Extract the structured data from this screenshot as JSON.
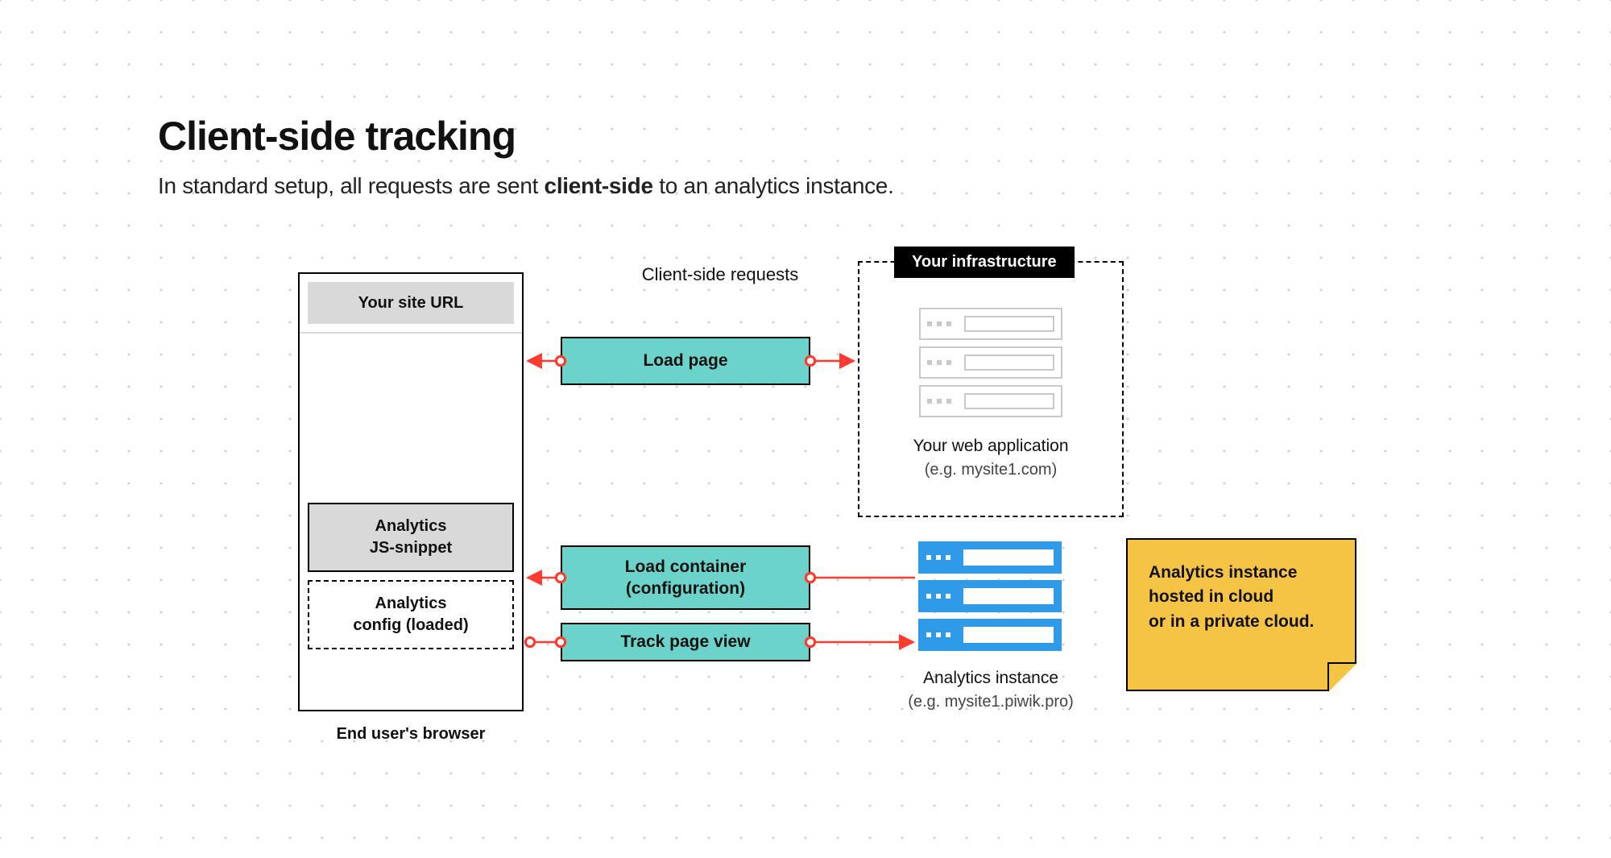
{
  "title": "Client-side tracking",
  "subtitle_pre": "In standard setup, all requests are sent ",
  "subtitle_bold": "client-side",
  "subtitle_post": " to an analytics instance.",
  "requests_label": "Client-side requests",
  "browser": {
    "url_label": "Your site URL",
    "snippet_l1": "Analytics",
    "snippet_l2": "JS-snippet",
    "config_l1": "Analytics",
    "config_l2": "config (loaded)",
    "caption": "End user's browser"
  },
  "requests": {
    "load_page": "Load page",
    "load_container_l1": "Load container",
    "load_container_l2": "(configuration)",
    "track_page_view": "Track page view"
  },
  "infrastructure": {
    "label": "Your infrastructure",
    "caption": "Your web application",
    "example": "(e.g. mysite1.com)"
  },
  "analytics": {
    "caption": "Analytics instance",
    "example": "(e.g. mysite1.piwik.pro)"
  },
  "note_l1": "Analytics instance",
  "note_l2": "hosted in cloud",
  "note_l3": "or in a private cloud.",
  "colors": {
    "teal": "#6cd3ca",
    "blue": "#2f9ae8",
    "note": "#f6c445",
    "arrow": "#ff3b30"
  }
}
